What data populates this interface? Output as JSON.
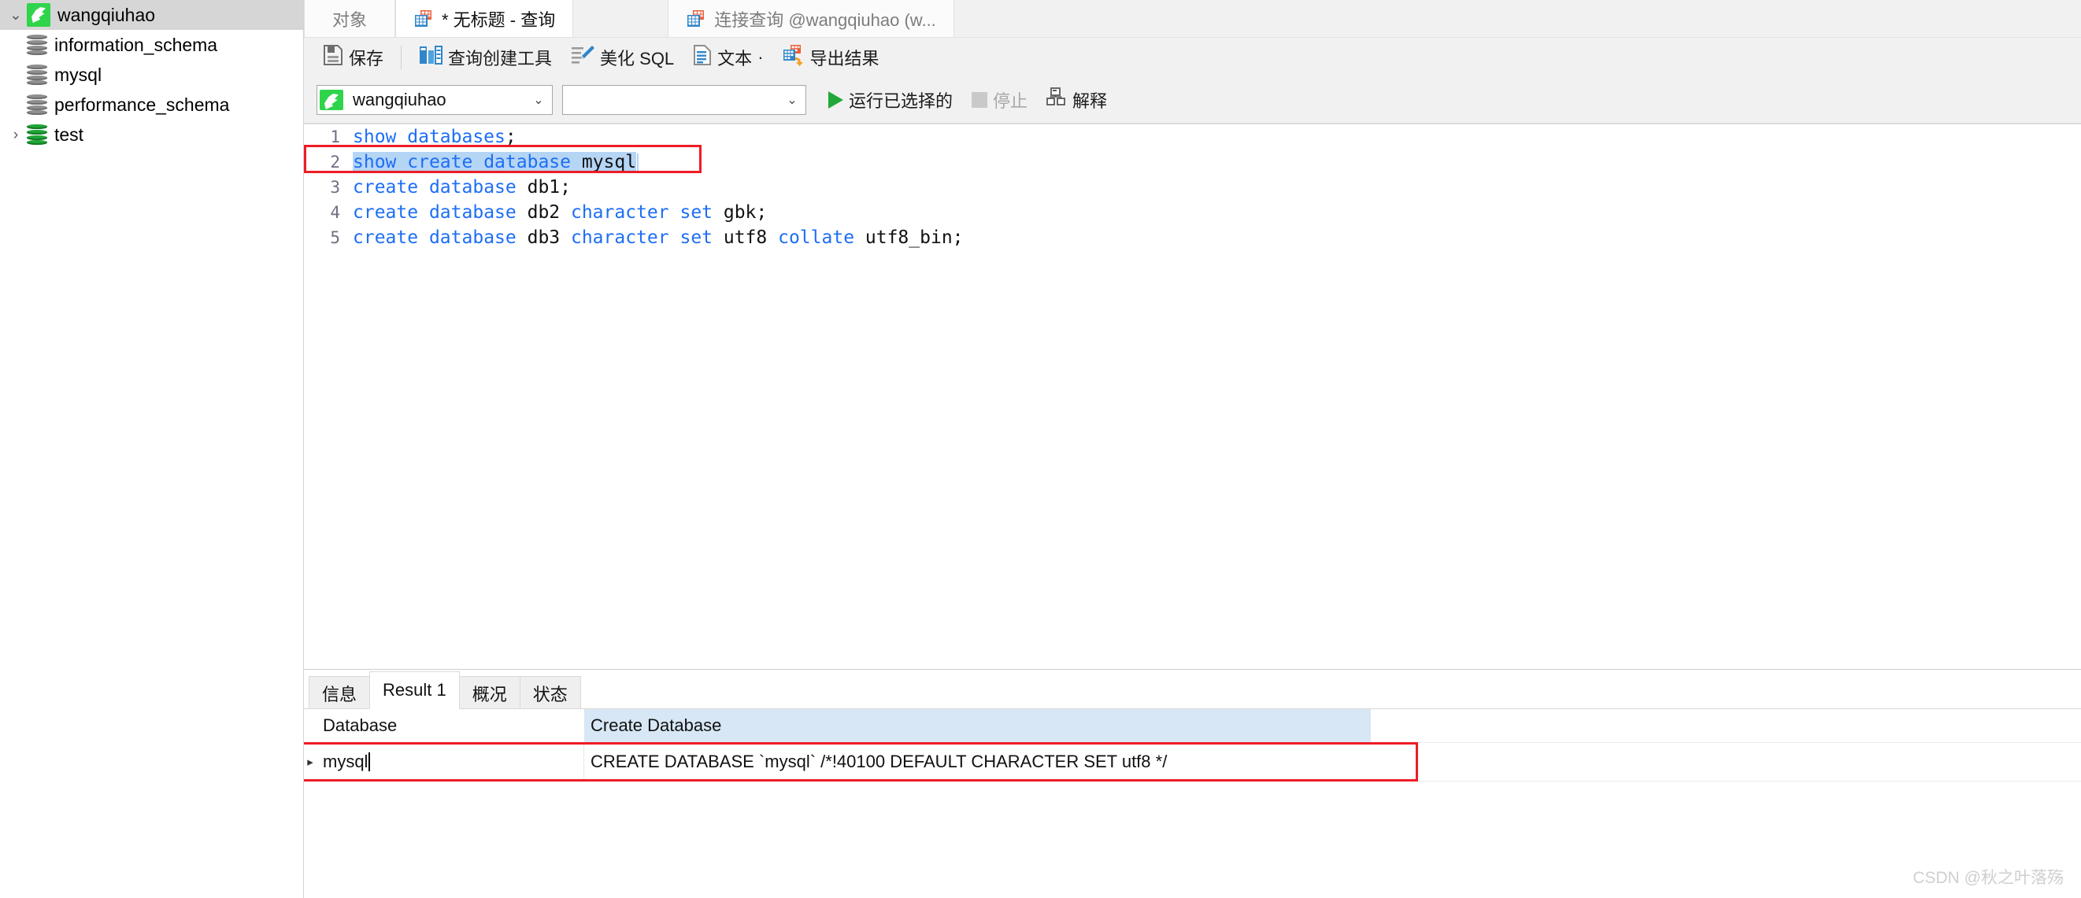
{
  "sidebar": {
    "connection": {
      "label": "wangqiuhao",
      "icon": "navicat-connection-icon",
      "expanded": "⌄"
    },
    "items": [
      {
        "label": "information_schema",
        "icon": "database-icon",
        "state": "closed"
      },
      {
        "label": "mysql",
        "icon": "database-icon",
        "state": "closed"
      },
      {
        "label": "performance_schema",
        "icon": "database-icon",
        "state": "closed"
      },
      {
        "label": "test",
        "icon": "database-icon-open",
        "state": "collapsed",
        "twisty": "›"
      }
    ]
  },
  "tabs": [
    {
      "label": "对象",
      "icon": "none",
      "active": false
    },
    {
      "label": "* 无标题 - 查询",
      "icon": "query-icon",
      "active": true
    },
    {
      "label": "连接查询 @wangqiuhao (w...",
      "icon": "query-icon",
      "active": false
    }
  ],
  "toolbar": {
    "save": "保存",
    "query_builder": "查询创建工具",
    "beautify_sql": "美化 SQL",
    "text": "文本",
    "text_caret": "·",
    "export_result": "导出结果",
    "db_select_value": "wangqiuhao",
    "object_select_value": "",
    "run_selected": "运行已选择的",
    "stop": "停止",
    "explain": "解释",
    "caret_glyph": "⌄"
  },
  "editor": {
    "lines": [
      {
        "num": "1",
        "tokens": [
          {
            "t": "show",
            "c": "kw"
          },
          {
            "t": " ",
            "c": "pl"
          },
          {
            "t": "databases",
            "c": "kw"
          },
          {
            "t": ";",
            "c": "pl"
          }
        ],
        "selected": false
      },
      {
        "num": "2",
        "tokens": [
          {
            "t": "show",
            "c": "kw"
          },
          {
            "t": " ",
            "c": "pl"
          },
          {
            "t": "create",
            "c": "kw"
          },
          {
            "t": " ",
            "c": "pl"
          },
          {
            "t": "database",
            "c": "kw"
          },
          {
            "t": " ",
            "c": "pl"
          },
          {
            "t": "mysql",
            "c": "pl"
          }
        ],
        "selected": true,
        "highlighted": true
      },
      {
        "num": "3",
        "tokens": [
          {
            "t": "create",
            "c": "kw"
          },
          {
            "t": " ",
            "c": "pl"
          },
          {
            "t": "database",
            "c": "kw"
          },
          {
            "t": " ",
            "c": "pl"
          },
          {
            "t": "db1;",
            "c": "pl"
          }
        ],
        "selected": false
      },
      {
        "num": "4",
        "tokens": [
          {
            "t": "create",
            "c": "kw"
          },
          {
            "t": " ",
            "c": "pl"
          },
          {
            "t": "database",
            "c": "kw"
          },
          {
            "t": " ",
            "c": "pl"
          },
          {
            "t": "db2 ",
            "c": "pl"
          },
          {
            "t": "character",
            "c": "kw"
          },
          {
            "t": " ",
            "c": "pl"
          },
          {
            "t": "set",
            "c": "kw"
          },
          {
            "t": " gbk;",
            "c": "pl"
          }
        ],
        "selected": false
      },
      {
        "num": "5",
        "tokens": [
          {
            "t": "create",
            "c": "kw"
          },
          {
            "t": " ",
            "c": "pl"
          },
          {
            "t": "database",
            "c": "kw"
          },
          {
            "t": " ",
            "c": "pl"
          },
          {
            "t": "db3 ",
            "c": "pl"
          },
          {
            "t": "character",
            "c": "kw"
          },
          {
            "t": " ",
            "c": "pl"
          },
          {
            "t": "set",
            "c": "kw"
          },
          {
            "t": " utf8 ",
            "c": "pl"
          },
          {
            "t": "collate",
            "c": "kw"
          },
          {
            "t": " utf8_bin;",
            "c": "pl"
          }
        ],
        "selected": false
      }
    ]
  },
  "result": {
    "tabs": [
      {
        "label": "信息",
        "active": false
      },
      {
        "label": "Result 1",
        "active": true
      },
      {
        "label": "概况",
        "active": false
      },
      {
        "label": "状态",
        "active": false
      }
    ],
    "columns": [
      "Database",
      "Create Database"
    ],
    "rows": [
      {
        "marker": "▸",
        "cells": [
          "mysql",
          "CREATE DATABASE `mysql` /*!40100 DEFAULT CHARACTER SET utf8 */"
        ]
      }
    ]
  },
  "watermark": "CSDN @秋之叶落殇",
  "colors": {
    "accent_green": "#2fd44a",
    "keyword_blue": "#1d6ef5",
    "highlight_red": "#ee1c25",
    "selection_blue": "#b5d5f5",
    "header_blue": "#d7e7f5"
  }
}
